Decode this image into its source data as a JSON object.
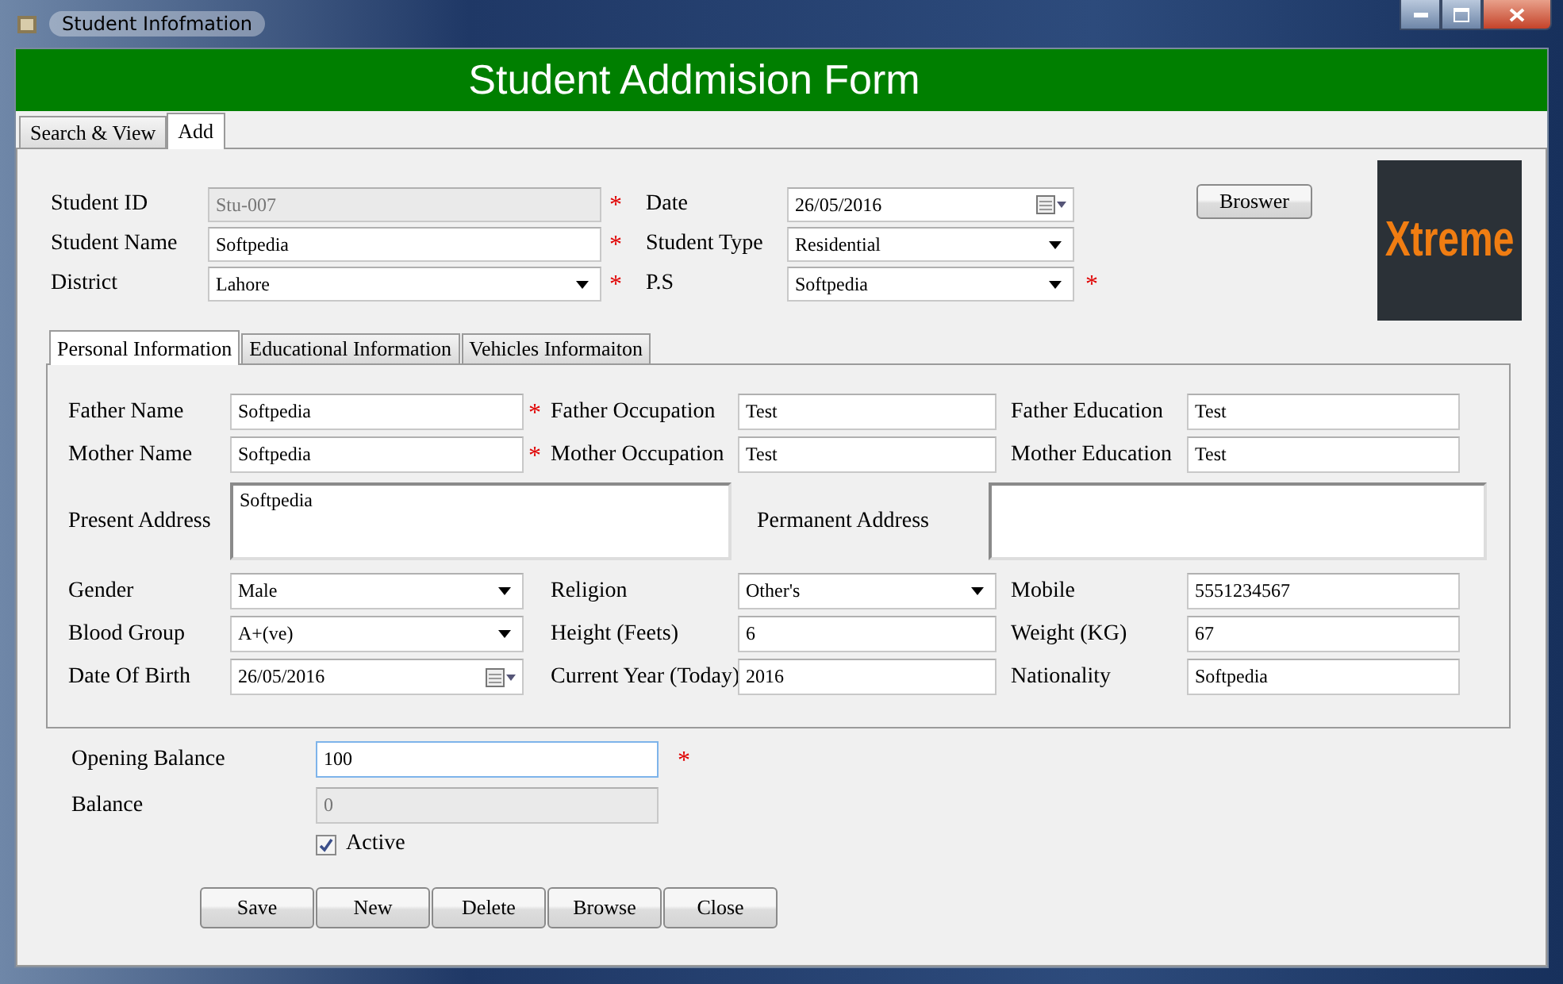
{
  "window": {
    "title": "Student Infofmation"
  },
  "header": {
    "title": "Student Addmision Form"
  },
  "tabs": [
    {
      "label": "Search & View",
      "selected": false
    },
    {
      "label": "Add",
      "selected": true
    }
  ],
  "top": {
    "rows": [
      [
        {
          "label": "Student ID",
          "value": "Stu-007",
          "kind": "readonly",
          "required_mark": "*"
        },
        {
          "label": "Date",
          "value": "26/05/2016",
          "kind": "date"
        }
      ],
      [
        {
          "label": "Student Name",
          "value": "Softpedia",
          "kind": "text",
          "required_mark": "*"
        },
        {
          "label": "Student Type",
          "value": "Residential",
          "kind": "dropdown"
        }
      ],
      [
        {
          "label": "District",
          "value": "Lahore",
          "kind": "dropdown",
          "required_mark": "*"
        },
        {
          "label": "P.S",
          "value": "Softpedia",
          "kind": "dropdown",
          "required_mark": "*"
        }
      ]
    ],
    "browse_button": "Broswer",
    "logo": {
      "text": "Xtreme"
    }
  },
  "inner_tabs": [
    {
      "label": "Personal Information",
      "selected": true
    },
    {
      "label": "Educational Information",
      "selected": false
    },
    {
      "label": "Vehicles Informaiton",
      "selected": false
    }
  ],
  "personal": {
    "rows": [
      [
        {
          "label": "Father Name",
          "value": "Softpedia",
          "kind": "text",
          "required_mark": "*"
        },
        {
          "label": "Father Occupation",
          "value": "Test",
          "kind": "text"
        },
        {
          "label": "Father Education",
          "value": "Test",
          "kind": "text"
        }
      ],
      [
        {
          "label": "Mother Name",
          "value": "Softpedia",
          "kind": "text",
          "required_mark": "*"
        },
        {
          "label": "Mother Occupation",
          "value": "Test",
          "kind": "text"
        },
        {
          "label": "Mother Education",
          "value": "Test",
          "kind": "text"
        }
      ],
      [
        {
          "label": "Present Address",
          "value": "Softpedia",
          "kind": "textarea"
        },
        {
          "label": "Permanent Address",
          "kind": "textarea"
        }
      ],
      [
        {
          "label": "Gender",
          "value": "Male",
          "kind": "dropdown"
        },
        {
          "label": "Religion",
          "value": "Other's",
          "kind": "dropdown"
        },
        {
          "label": "Mobile",
          "value": "5551234567",
          "kind": "text"
        }
      ],
      [
        {
          "label": "Blood Group",
          "value": "A+(ve)",
          "kind": "dropdown"
        },
        {
          "label": "Height (Feets)",
          "value": "6",
          "kind": "text"
        },
        {
          "label": "Weight (KG)",
          "value": "67",
          "kind": "text"
        }
      ],
      [
        {
          "label": "Date Of Birth",
          "value": "26/05/2016",
          "kind": "date"
        },
        {
          "label": "Current Year (Today)",
          "value": "2016",
          "kind": "text"
        },
        {
          "label": "Nationality",
          "value": "Softpedia",
          "kind": "text"
        }
      ]
    ]
  },
  "balance": {
    "rows": [
      {
        "label": "Opening Balance",
        "value": "100",
        "kind": "text",
        "required_mark": "*"
      },
      {
        "label": "Balance",
        "value": "0",
        "kind": "readonly"
      }
    ],
    "active": {
      "label": "Active",
      "checked": true
    }
  },
  "buttons": [
    "Save",
    "New",
    "Delete",
    "Browse",
    "Close"
  ]
}
